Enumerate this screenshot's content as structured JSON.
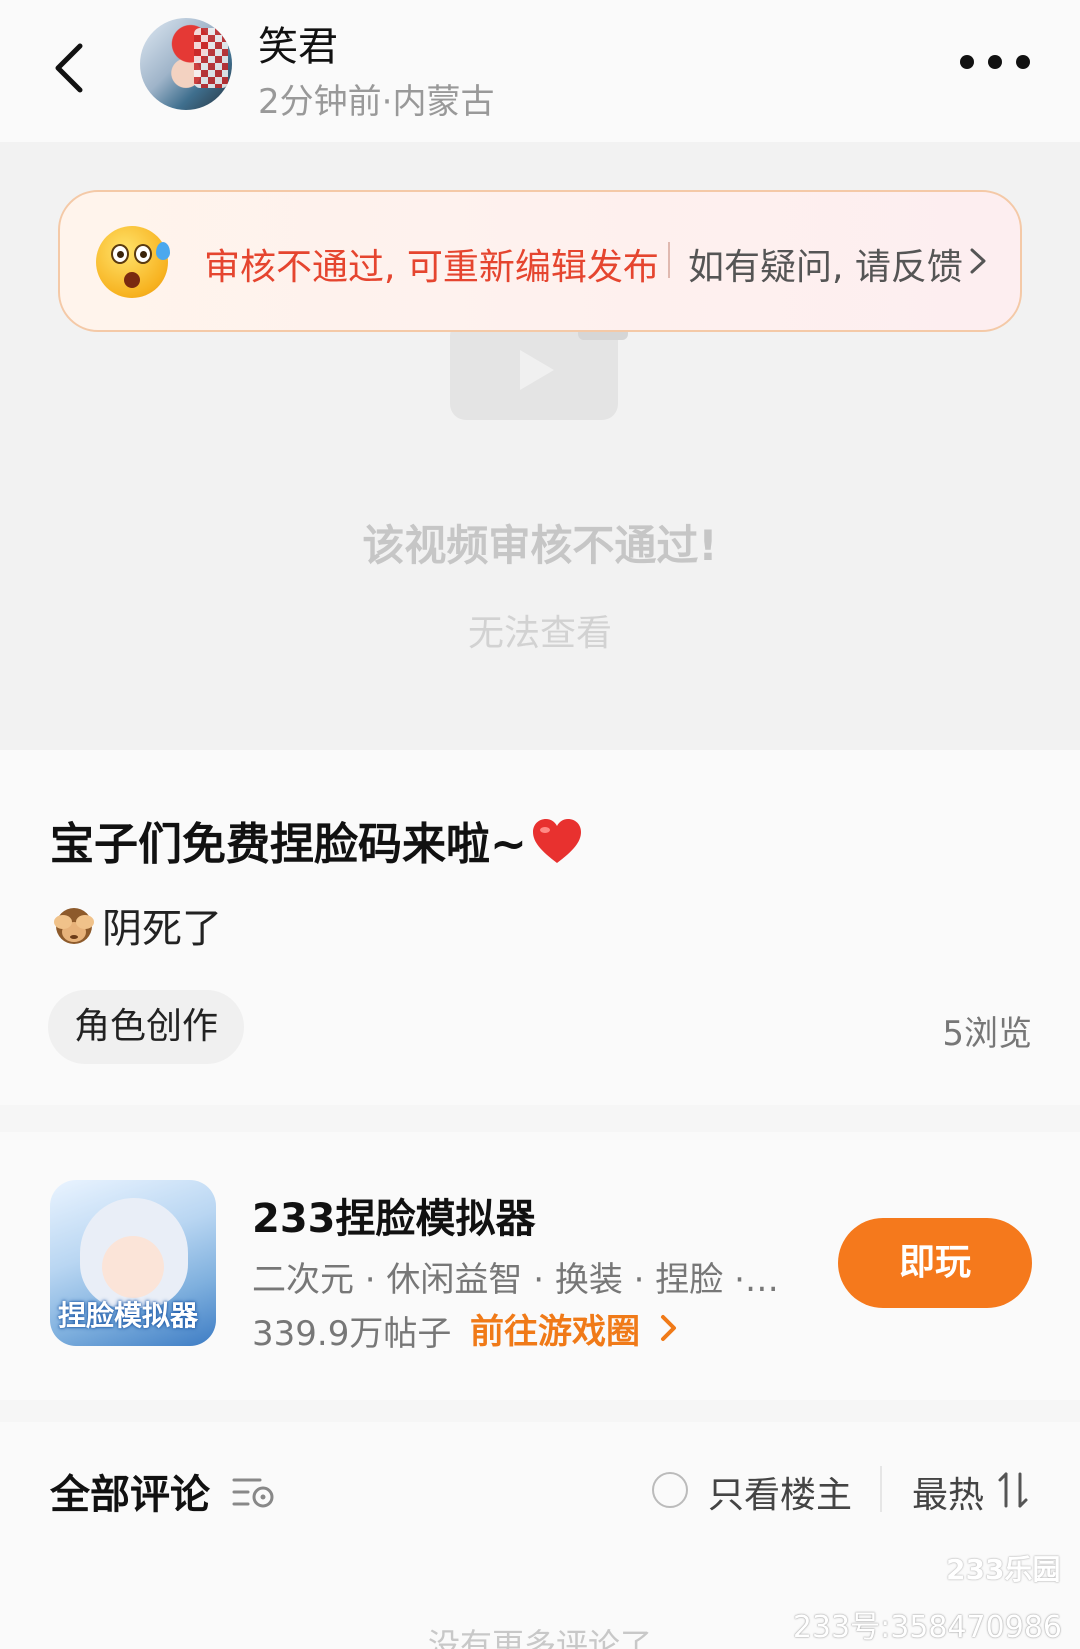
{
  "header": {
    "username": "笑君",
    "meta": "2分钟前·内蒙古"
  },
  "review_banner": {
    "status": "审核不通过, 可重新编辑发布",
    "feedback": "如有疑问, 请反馈"
  },
  "video": {
    "fail_title": "该视频审核不通过!",
    "fail_sub": "无法查看"
  },
  "post": {
    "title": "宝子们免费捏脸码来啦~",
    "body": "阴死了",
    "tag": "角色创作",
    "views": "5浏览"
  },
  "game": {
    "name": "233捏脸模拟器",
    "tags": "二次元 · 休闲益智 · 换装 · 捏脸 ·…",
    "posts": "339.9万帖子",
    "link": "前往游戏圈",
    "play_label": "即玩",
    "icon_text": "捏脸模拟器"
  },
  "comments": {
    "title": "全部评论",
    "only_op": "只看楼主",
    "sort": "最热",
    "no_more": "没有更多评论了"
  },
  "watermark": {
    "logo": "233乐园",
    "id": "233号:358470986"
  },
  "colors": {
    "accent_orange": "#f5791c",
    "review_red": "#e5452f"
  }
}
